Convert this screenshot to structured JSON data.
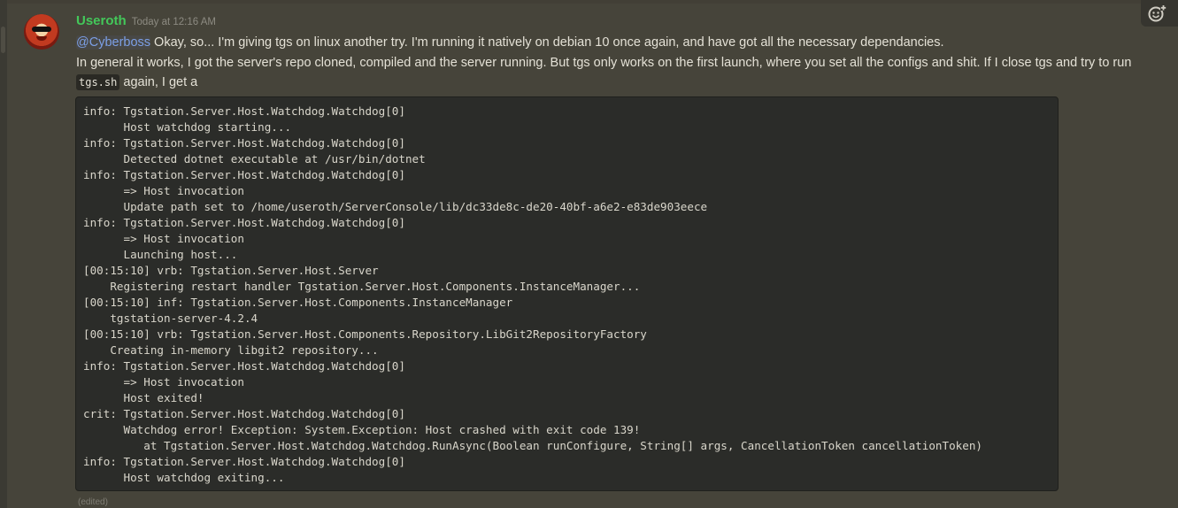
{
  "message": {
    "author": "Useroth",
    "timestamp": "Today at 12:16 AM",
    "mention": "@Cyberboss",
    "line1_rest": " Okay, so... I'm giving tgs on linux another try. I'm running it natively on debian 10 once again, and have got all the necessary dependancies.",
    "line2": "In general it works, I got the server's repo cloned, compiled and the server running. But tgs only works on the first launch, where you set all the configs and shit. If I close tgs and try to run",
    "inline_code": "tgs.sh",
    "line3_rest": " again, I get a",
    "code_block": "info: Tgstation.Server.Host.Watchdog.Watchdog[0]\n      Host watchdog starting...\ninfo: Tgstation.Server.Host.Watchdog.Watchdog[0]\n      Detected dotnet executable at /usr/bin/dotnet\ninfo: Tgstation.Server.Host.Watchdog.Watchdog[0]\n      => Host invocation\n      Update path set to /home/useroth/ServerConsole/lib/dc33de8c-de20-40bf-a6e2-e83de903eece\ninfo: Tgstation.Server.Host.Watchdog.Watchdog[0]\n      => Host invocation\n      Launching host...\n[00:15:10] vrb: Tgstation.Server.Host.Server\n    Registering restart handler Tgstation.Server.Host.Components.InstanceManager...\n[00:15:10] inf: Tgstation.Server.Host.Components.InstanceManager\n    tgstation-server-4.2.4\n[00:15:10] vrb: Tgstation.Server.Host.Components.Repository.LibGit2RepositoryFactory\n    Creating in-memory libgit2 repository...\ninfo: Tgstation.Server.Host.Watchdog.Watchdog[0]\n      => Host invocation\n      Host exited!\ncrit: Tgstation.Server.Host.Watchdog.Watchdog[0]\n      Watchdog error! Exception: System.Exception: Host crashed with exit code 139!\n         at Tgstation.Server.Host.Watchdog.Watchdog.RunAsync(Boolean runConfigure, String[] args, CancellationToken cancellationToken)\ninfo: Tgstation.Server.Host.Watchdog.Watchdog[0]\n      Host watchdog exiting...",
    "edited": "(edited)"
  },
  "toolbar": {
    "react_icon": "add-reaction-icon"
  },
  "colors": {
    "background": "#46443a",
    "username": "#43c85a",
    "mention": "#7c9fe6",
    "codeblock_bg": "#2b2c29"
  }
}
